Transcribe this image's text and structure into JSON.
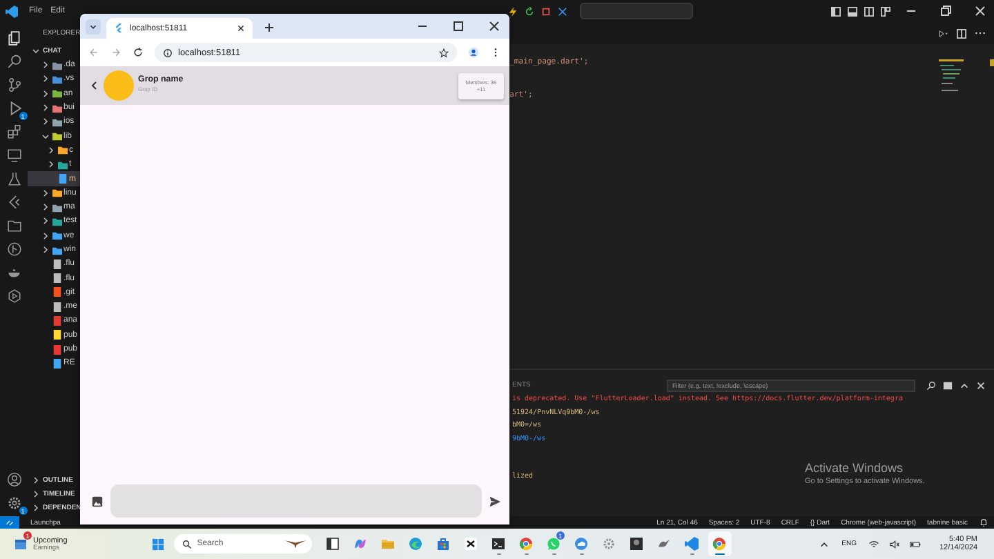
{
  "vscode": {
    "menu": [
      "File",
      "Edit"
    ],
    "activity_badges": {
      "run": "1",
      "settings": "1"
    },
    "explorer": {
      "title": "EXPLORER",
      "workspace": "CHAT",
      "tree": [
        {
          "label": ".da",
          "kind": "folder",
          "expanded": false,
          "selected": false,
          "color": "#8a94a6"
        },
        {
          "label": ".vs",
          "kind": "folder",
          "expanded": false,
          "selected": false,
          "color": "#4a8fd8"
        },
        {
          "label": "an",
          "kind": "folder",
          "expanded": false,
          "selected": false,
          "color": "#7cb342"
        },
        {
          "label": "bui",
          "kind": "folder",
          "expanded": false,
          "selected": false,
          "color": "#e57373"
        },
        {
          "label": "ios",
          "kind": "folder",
          "expanded": false,
          "selected": false,
          "color": "#90a4ae"
        },
        {
          "label": "lib",
          "kind": "folder",
          "expanded": true,
          "selected": false,
          "color": "#c0ca33",
          "children": [
            {
              "label": "c",
              "kind": "folder",
              "expanded": false,
              "selected": false,
              "color": "#ffa726"
            },
            {
              "label": "t",
              "kind": "folder",
              "expanded": false,
              "selected": false,
              "color": "#26a69a"
            },
            {
              "label": "m",
              "kind": "file",
              "selected": true,
              "color": "#42a5f5"
            }
          ]
        },
        {
          "label": "linu",
          "kind": "folder",
          "expanded": false,
          "selected": false,
          "color": "#ffa726"
        },
        {
          "label": "ma",
          "kind": "folder",
          "expanded": false,
          "selected": false,
          "color": "#90a4ae"
        },
        {
          "label": "test",
          "kind": "folder",
          "expanded": false,
          "selected": false,
          "color": "#26a69a"
        },
        {
          "label": "we",
          "kind": "folder",
          "expanded": false,
          "selected": false,
          "color": "#42a5f5"
        },
        {
          "label": "win",
          "kind": "folder",
          "expanded": false,
          "selected": false,
          "color": "#42a5f5"
        },
        {
          "label": ".flu",
          "kind": "file",
          "selected": false,
          "color": "#bdbdbd"
        },
        {
          "label": ".flu",
          "kind": "file",
          "selected": false,
          "color": "#bdbdbd"
        },
        {
          "label": ".git",
          "kind": "file",
          "selected": false,
          "color": "#f4511e"
        },
        {
          "label": ".me",
          "kind": "file",
          "selected": false,
          "color": "#bdbdbd"
        },
        {
          "label": "ana",
          "kind": "file",
          "selected": false,
          "color": "#e53935"
        },
        {
          "label": "pub",
          "kind": "file",
          "selected": false,
          "color": "#fdd835"
        },
        {
          "label": "pub",
          "kind": "file",
          "selected": false,
          "color": "#e53935"
        },
        {
          "label": "RE",
          "kind": "file",
          "selected": false,
          "color": "#42a5f5"
        }
      ],
      "sections": [
        "OUTLINE",
        "TIMELINE",
        "DEPENDEN"
      ]
    },
    "code_lines": [
      "_main_page.dart';",
      "art';"
    ],
    "panel": {
      "tab": "ENTS",
      "filter_placeholder": "Filter (e.g. text, !exclude, \\escape)",
      "lines": [
        {
          "text": "is deprecated. Use \"FlutterLoader.load\" instead. See https://docs.flutter.dev/platform-integra",
          "kind": "error"
        },
        {
          "text": "51924/PnvNLVq9bM0-/ws",
          "kind": "warning"
        },
        {
          "text": "bM0=/ws",
          "kind": "warning"
        },
        {
          "text": "9bM0-/ws",
          "kind": "info"
        },
        {
          "text": "lized",
          "kind": "warning"
        }
      ]
    },
    "activation": {
      "title": "Activate Windows",
      "subtitle": "Go to Settings to activate Windows."
    },
    "status_bar": {
      "left": "Launchpa",
      "items": [
        "Ln 21, Col 46",
        "Spaces: 2",
        "UTF-8",
        "CRLF",
        "{} Dart",
        "Chrome (web-javascript)",
        "tabnine basic"
      ]
    }
  },
  "browser": {
    "tab_title": "localhost:51811",
    "url": "localhost:51811",
    "app": {
      "group_name": "Grop name",
      "group_id": "Grop ID",
      "members": "Members: 36",
      "members_extra": "+11"
    }
  },
  "taskbar": {
    "widget": {
      "badge": "1",
      "title": "Upcoming",
      "subtitle": "Earnings"
    },
    "search_placeholder": "Search",
    "apps": [
      {
        "kind": "desktop",
        "open": false,
        "selected": false
      },
      {
        "kind": "copilot",
        "open": false,
        "selected": false
      },
      {
        "kind": "folder",
        "open": false,
        "selected": false
      },
      {
        "kind": "edge",
        "open": false,
        "selected": false
      },
      {
        "kind": "store",
        "open": false,
        "selected": false
      },
      {
        "kind": "capcut",
        "open": false,
        "selected": false
      },
      {
        "kind": "terminal",
        "open": true,
        "selected": false
      },
      {
        "kind": "chrome",
        "open": true,
        "selected": false
      },
      {
        "kind": "whatsapp",
        "open": true,
        "selected": false,
        "badge": "1"
      },
      {
        "kind": "cloud",
        "open": true,
        "selected": false
      },
      {
        "kind": "gear",
        "open": false,
        "selected": false
      },
      {
        "kind": "photo",
        "open": false,
        "selected": false
      },
      {
        "kind": "bird",
        "open": false,
        "selected": false
      },
      {
        "kind": "vscode",
        "open": true,
        "selected": false
      },
      {
        "kind": "chrome",
        "open": true,
        "selected": true
      }
    ],
    "language": "ENG",
    "time": "5:40 PM",
    "date": "12/14/2024"
  }
}
